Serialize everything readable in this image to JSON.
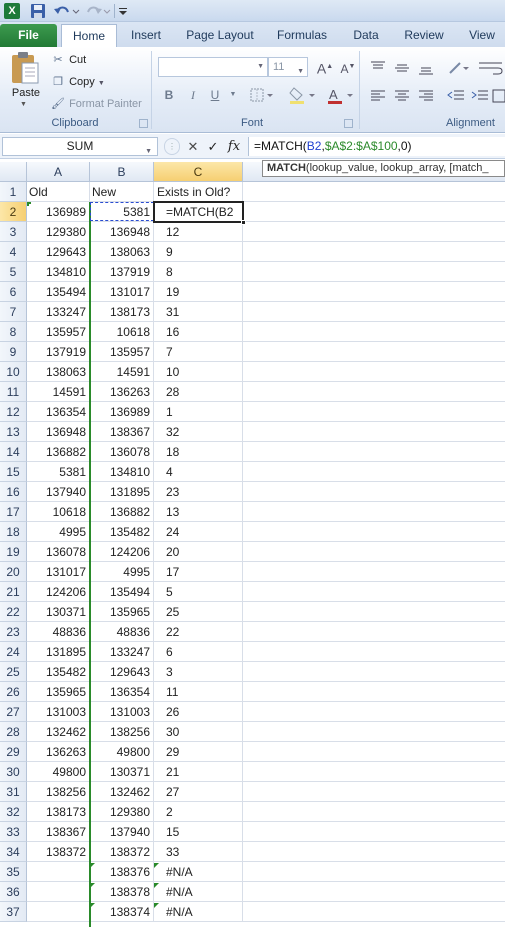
{
  "qat": {
    "app_icon": "excel-x-icon",
    "app_letter": "X",
    "save_icon": "save-icon",
    "undo_icon": "undo-icon",
    "redo_icon": "redo-icon",
    "more_icon": "customize-qat-icon"
  },
  "tabs": [
    {
      "label": "File"
    },
    {
      "label": "Home"
    },
    {
      "label": "Insert"
    },
    {
      "label": "Page Layout"
    },
    {
      "label": "Formulas"
    },
    {
      "label": "Data"
    },
    {
      "label": "Review"
    },
    {
      "label": "View"
    }
  ],
  "ribbon": {
    "clipboard": {
      "paste": "Paste",
      "cut": "Cut",
      "copy": "Copy",
      "format_painter": "Format Painter",
      "group_label": "Clipboard"
    },
    "font": {
      "font_size": "11",
      "group_label": "Font",
      "bold": "B",
      "italic": "I",
      "underline": "U"
    },
    "alignment": {
      "group_label": "Alignment"
    }
  },
  "formula_bar": {
    "name_box": "SUM",
    "cancel": "✕",
    "enter": "✓",
    "fx": "fx",
    "formula_parts": [
      "=MATCH(",
      "B2",
      ",",
      "$A$2:$A$100",
      ",0)"
    ]
  },
  "tooltip": {
    "func": "MATCH",
    "args": "(lookup_value, lookup_array, [match_"
  },
  "columns": [
    "A",
    "B",
    "C"
  ],
  "header_row": {
    "row": "1",
    "a": "Old",
    "b": "New",
    "c": "Exists in Old?"
  },
  "rows": [
    {
      "row": "2",
      "a": "136989",
      "b": "5381",
      "c": "=MATCH(B2"
    },
    {
      "row": "3",
      "a": "129380",
      "b": "136948",
      "c": "12"
    },
    {
      "row": "4",
      "a": "129643",
      "b": "138063",
      "c": "9"
    },
    {
      "row": "5",
      "a": "134810",
      "b": "137919",
      "c": "8"
    },
    {
      "row": "6",
      "a": "135494",
      "b": "131017",
      "c": "19"
    },
    {
      "row": "7",
      "a": "133247",
      "b": "138173",
      "c": "31"
    },
    {
      "row": "8",
      "a": "135957",
      "b": "10618",
      "c": "16"
    },
    {
      "row": "9",
      "a": "137919",
      "b": "135957",
      "c": "7"
    },
    {
      "row": "10",
      "a": "138063",
      "b": "14591",
      "c": "10"
    },
    {
      "row": "11",
      "a": "14591",
      "b": "136263",
      "c": "28"
    },
    {
      "row": "12",
      "a": "136354",
      "b": "136989",
      "c": "1"
    },
    {
      "row": "13",
      "a": "136948",
      "b": "138367",
      "c": "32"
    },
    {
      "row": "14",
      "a": "136882",
      "b": "136078",
      "c": "18"
    },
    {
      "row": "15",
      "a": "5381",
      "b": "134810",
      "c": "4"
    },
    {
      "row": "16",
      "a": "137940",
      "b": "131895",
      "c": "23"
    },
    {
      "row": "17",
      "a": "10618",
      "b": "136882",
      "c": "13"
    },
    {
      "row": "18",
      "a": "4995",
      "b": "135482",
      "c": "24"
    },
    {
      "row": "19",
      "a": "136078",
      "b": "124206",
      "c": "20"
    },
    {
      "row": "20",
      "a": "131017",
      "b": "4995",
      "c": "17"
    },
    {
      "row": "21",
      "a": "124206",
      "b": "135494",
      "c": "5"
    },
    {
      "row": "22",
      "a": "130371",
      "b": "135965",
      "c": "25"
    },
    {
      "row": "23",
      "a": "48836",
      "b": "48836",
      "c": "22"
    },
    {
      "row": "24",
      "a": "131895",
      "b": "133247",
      "c": "6"
    },
    {
      "row": "25",
      "a": "135482",
      "b": "129643",
      "c": "3"
    },
    {
      "row": "26",
      "a": "135965",
      "b": "136354",
      "c": "11"
    },
    {
      "row": "27",
      "a": "131003",
      "b": "131003",
      "c": "26"
    },
    {
      "row": "28",
      "a": "132462",
      "b": "138256",
      "c": "30"
    },
    {
      "row": "29",
      "a": "136263",
      "b": "49800",
      "c": "29"
    },
    {
      "row": "30",
      "a": "49800",
      "b": "130371",
      "c": "21"
    },
    {
      "row": "31",
      "a": "138256",
      "b": "132462",
      "c": "27"
    },
    {
      "row": "32",
      "a": "138173",
      "b": "129380",
      "c": "2"
    },
    {
      "row": "33",
      "a": "138367",
      "b": "137940",
      "c": "15"
    },
    {
      "row": "34",
      "a": "138372",
      "b": "138372",
      "c": "33"
    },
    {
      "row": "35",
      "a": "",
      "b": "138376",
      "c": "#N/A"
    },
    {
      "row": "36",
      "a": "",
      "b": "138378",
      "c": "#N/A"
    },
    {
      "row": "37",
      "a": "",
      "b": "138374",
      "c": "#N/A"
    }
  ],
  "colors": {
    "accent_green": "#2a8a2a",
    "selection_header": "#f6cf72",
    "reference_blue": "#2040d0"
  }
}
